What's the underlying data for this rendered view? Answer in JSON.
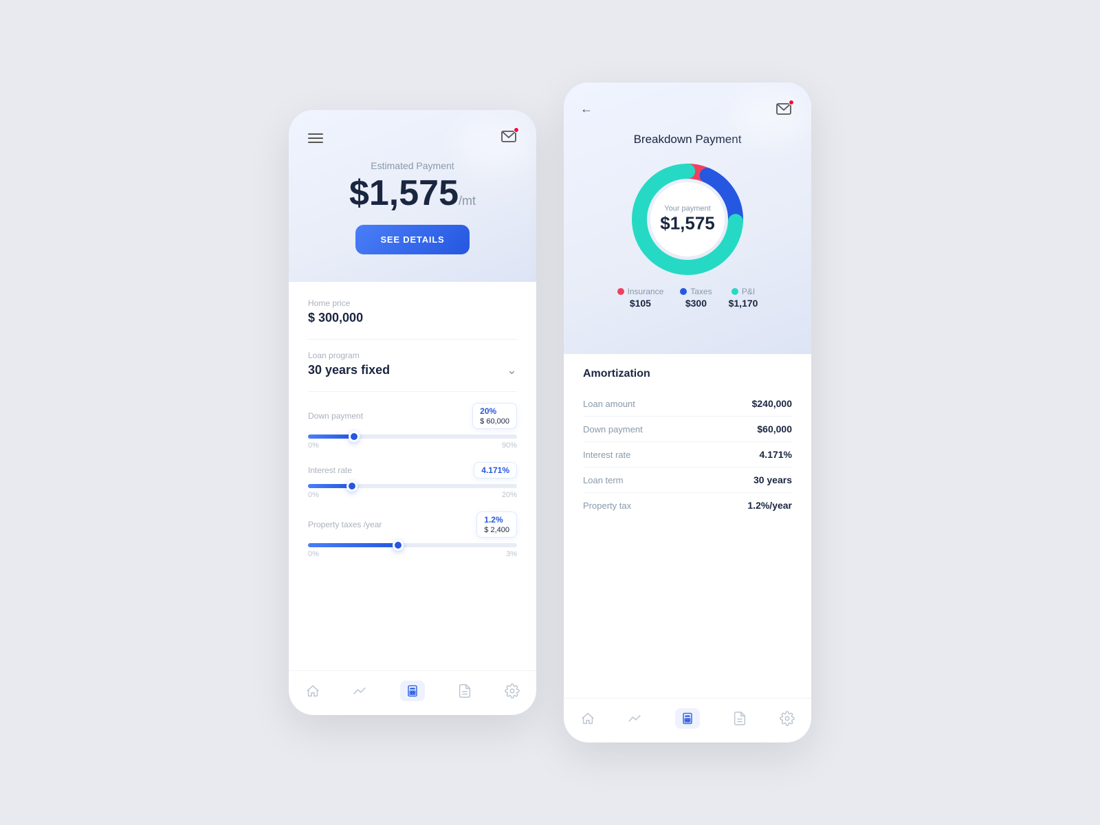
{
  "background": "#e8eaf0",
  "left_phone": {
    "header": {
      "estimated_label": "Estimated Payment",
      "payment_amount": "$1,575",
      "payment_unit": "/mt",
      "see_details_label": "SEE DETAILS"
    },
    "home_price": {
      "label": "Home price",
      "value": "$ 300,000"
    },
    "loan_program": {
      "label": "Loan program",
      "value": "30 years fixed"
    },
    "down_payment": {
      "label": "Down payment",
      "percent_badge": "20%",
      "amount_badge": "$ 60,000",
      "fill_pct": 22,
      "thumb_pct": 22,
      "min_label": "0%",
      "max_label": "90%"
    },
    "interest_rate": {
      "label": "Interest rate",
      "badge": "4.171%",
      "fill_pct": 21,
      "thumb_pct": 21,
      "min_label": "0%",
      "max_label": "20%"
    },
    "property_taxes": {
      "label": "Property taxes /year",
      "percent_badge": "1.2%",
      "amount_badge": "$ 2,400",
      "fill_pct": 43,
      "thumb_pct": 43,
      "min_label": "0%",
      "max_label": "3%"
    },
    "nav": {
      "items": [
        {
          "name": "home",
          "active": false
        },
        {
          "name": "chart",
          "active": false
        },
        {
          "name": "calculator",
          "active": true
        },
        {
          "name": "document",
          "active": false
        },
        {
          "name": "settings",
          "active": false
        }
      ]
    }
  },
  "right_phone": {
    "header": {
      "breakdown_title": "Breakdown Payment"
    },
    "donut": {
      "center_label": "Your payment",
      "center_amount": "$1,575",
      "segments": [
        {
          "name": "Insurance",
          "value": "$105",
          "color": "#f04060",
          "percent": 6.7
        },
        {
          "name": "Taxes",
          "value": "$300",
          "color": "#2557e0",
          "percent": 19
        },
        {
          "name": "P&I",
          "value": "$1,170",
          "color": "#26d9c4",
          "percent": 74.3
        }
      ]
    },
    "amortization": {
      "title": "Amortization",
      "rows": [
        {
          "key": "Loan amount",
          "value": "$240,000"
        },
        {
          "key": "Down payment",
          "value": "$60,000"
        },
        {
          "key": "Interest rate",
          "value": "4.171%"
        },
        {
          "key": "Loan term",
          "value": "30 years"
        },
        {
          "key": "Property tax",
          "value": "1.2%/year"
        }
      ]
    },
    "nav": {
      "items": [
        {
          "name": "home",
          "active": false
        },
        {
          "name": "chart",
          "active": false
        },
        {
          "name": "calculator",
          "active": true
        },
        {
          "name": "document",
          "active": false
        },
        {
          "name": "settings",
          "active": false
        }
      ]
    }
  }
}
